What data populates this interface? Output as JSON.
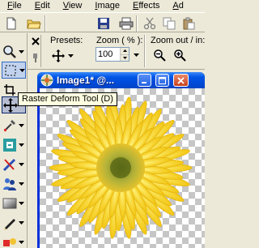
{
  "menu": {
    "items": [
      {
        "label": "File",
        "ul": "F",
        "rest": "ile"
      },
      {
        "label": "Edit",
        "ul": "E",
        "rest": "dit"
      },
      {
        "label": "View",
        "ul": "V",
        "rest": "iew"
      },
      {
        "label": "Image",
        "ul": "I",
        "rest": "mage"
      },
      {
        "label": "Effects",
        "ul": "E",
        "rest": "ffects"
      },
      {
        "label": "Ad",
        "ul": "A",
        "rest": "d"
      }
    ]
  },
  "toolbar": {
    "icons": [
      "new-icon",
      "open-icon",
      "save-icon",
      "print-icon",
      "cut-icon",
      "copy-icon",
      "paste-icon"
    ]
  },
  "tool_options": {
    "presets_label": "Presets:",
    "zoom_label": "Zoom ( % ):",
    "zoom_value": "100",
    "zoom_out_label": "Zoom out / in:"
  },
  "image_window": {
    "title": "Image1* @..."
  },
  "tooltip": {
    "text": "Raster Deform Tool (D)"
  },
  "colors": {
    "titlebar": "#0054e3",
    "tooltip_bg": "#ffffe1",
    "flower": "#f7d520",
    "flower_center": "#9aa02a"
  }
}
